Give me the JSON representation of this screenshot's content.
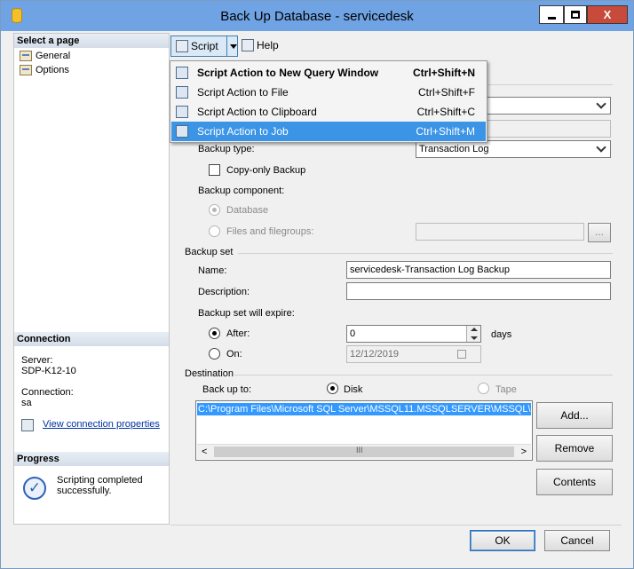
{
  "window": {
    "title": "Back Up Database - servicedesk",
    "close_glyph": "X"
  },
  "left_panel": {
    "select_page_header": "Select a page",
    "pages": [
      {
        "label": "General"
      },
      {
        "label": "Options"
      }
    ],
    "connection_header": "Connection",
    "server_label": "Server:",
    "server_value": "SDP-K12-10",
    "connection_label": "Connection:",
    "connection_value": "sa",
    "view_connection_link": "View connection properties",
    "progress_header": "Progress",
    "progress_status": "Scripting completed successfully."
  },
  "toolbar": {
    "script_label": "Script",
    "help_label": "Help"
  },
  "script_menu": {
    "items": [
      {
        "label": "Script Action to New Query Window",
        "shortcut": "Ctrl+Shift+N",
        "bold": true,
        "highlighted": false
      },
      {
        "label": "Script Action to File",
        "shortcut": "Ctrl+Shift+F",
        "bold": false,
        "highlighted": false
      },
      {
        "label": "Script Action to Clipboard",
        "shortcut": "Ctrl+Shift+C",
        "bold": false,
        "highlighted": false
      },
      {
        "label": "Script Action to Job",
        "shortcut": "Ctrl+Shift+M",
        "bold": false,
        "highlighted": true
      }
    ]
  },
  "source": {
    "backup_type_label": "Backup type:",
    "backup_type_value": "Transaction Log",
    "copy_only_label": "Copy-only Backup",
    "copy_only_checked": false,
    "component_label": "Backup component:",
    "component_database": "Database",
    "component_files": "Files and filegroups:",
    "browse_label": "..."
  },
  "backup_set": {
    "group_label": "Backup set",
    "name_label": "Name:",
    "name_value": "servicedesk-Transaction Log  Backup",
    "description_label": "Description:",
    "description_value": "",
    "expire_label": "Backup set will expire:",
    "after_label": "After:",
    "after_value": "0",
    "days_label": "days",
    "on_label": "On:",
    "on_value": "12/12/2019"
  },
  "destination": {
    "group_label": "Destination",
    "back_up_to_label": "Back up to:",
    "disk_label": "Disk",
    "tape_label": "Tape",
    "paths": [
      "C:\\Program Files\\Microsoft SQL Server\\MSSQL11.MSSQLSERVER\\MSSQL\\Backup\\servicedesk.bak"
    ],
    "scroll_grip": "III",
    "add_label": "Add...",
    "remove_label": "Remove",
    "contents_label": "Contents"
  },
  "footer": {
    "ok_label": "OK",
    "cancel_label": "Cancel"
  }
}
